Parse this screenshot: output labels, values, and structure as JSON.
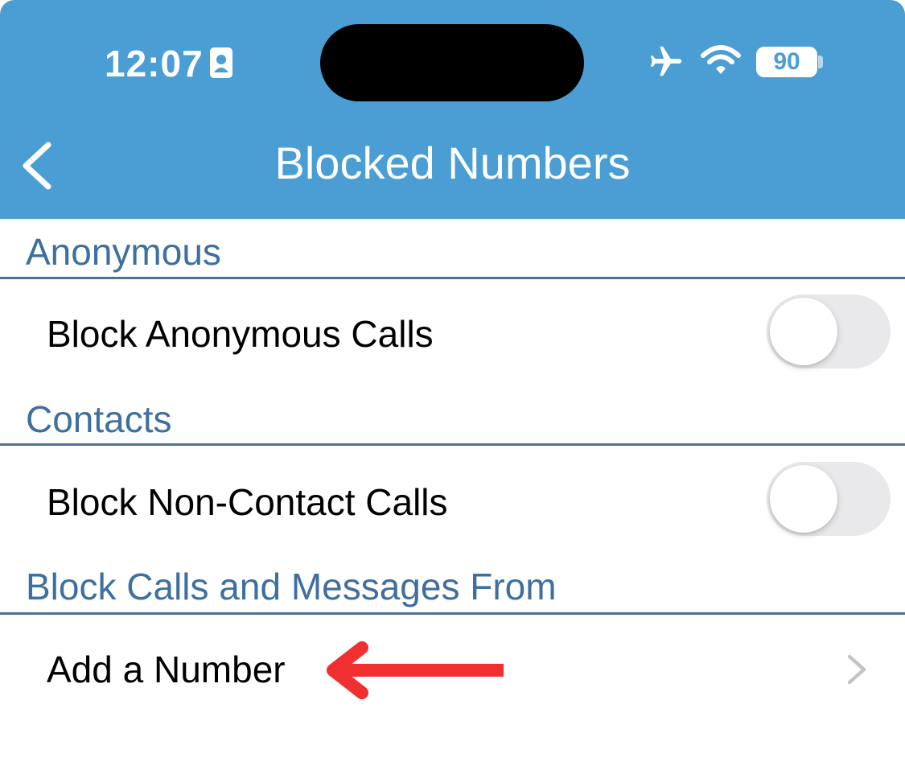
{
  "status_bar": {
    "time": "12:07",
    "battery": "90",
    "icons": [
      "id-card-icon",
      "airplane-mode-icon",
      "wifi-icon",
      "battery-icon"
    ]
  },
  "nav": {
    "title": "Blocked Numbers",
    "back_icon": "chevron-left-icon"
  },
  "sections": {
    "anonymous": {
      "header": "Anonymous",
      "row_label": "Block Anonymous Calls",
      "toggle_on": false
    },
    "contacts": {
      "header": "Contacts",
      "row_label": "Block Non-Contact Calls",
      "toggle_on": false
    },
    "block_from": {
      "header": "Block Calls and Messages From",
      "row_label": "Add a Number",
      "row_icon": "chevron-right-icon"
    }
  },
  "colors": {
    "header_bg": "#4a9ed3",
    "section_text": "#3e6f9e",
    "annotation_arrow": "#f03030"
  }
}
